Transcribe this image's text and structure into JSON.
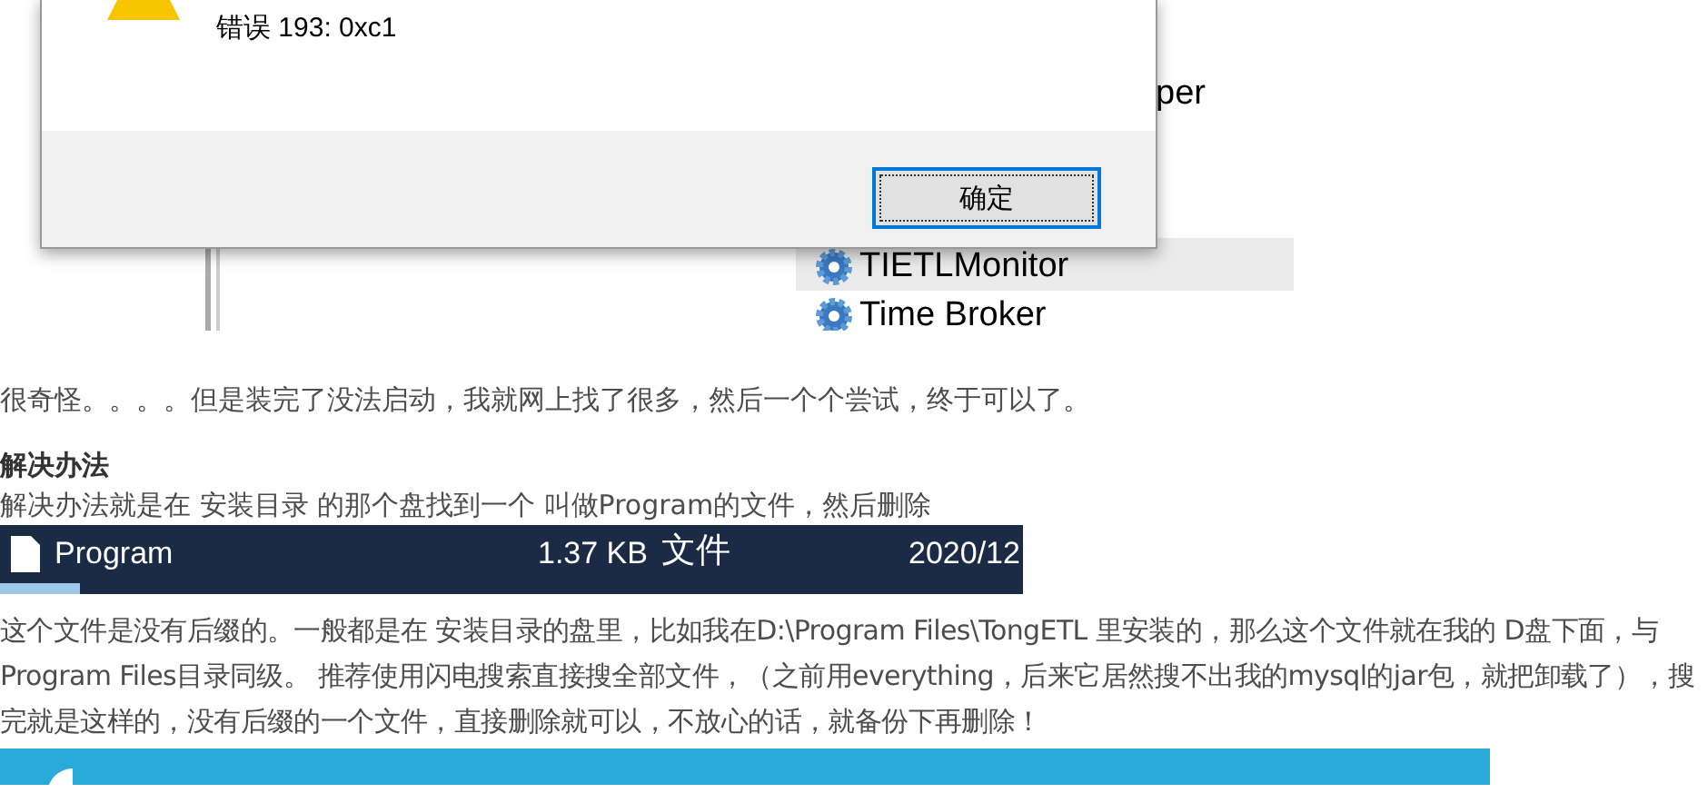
{
  "error_screenshot": {
    "message": "错误 193: 0xc1",
    "ok_button": "确定",
    "services": [
      {
        "name": "per"
      },
      {
        "name": "TIETLMonitor"
      },
      {
        "name": "Time Broker"
      }
    ]
  },
  "intro": "很奇怪。。。。但是装完了没法启动，我就网上找了很多，然后一个个尝试，终于可以了。",
  "heading": "解决办法",
  "solution": "解决办法就是在 安装目录 的那个盘找到一个 叫做Program的文件，然后删除",
  "file_row": {
    "name": "Program",
    "size": "1.37 KB",
    "type": "文件",
    "date": "2020/12"
  },
  "explanation": "这个文件是没有后缀的。一般都是在 安装目录的盘里，比如我在D:\\Program Files\\TongETL 里安装的，那么这个文件就在我的 D盘下面，与Program Files目录同级。 推荐使用闪电搜索直接搜全部文件，（之前用everything，后来它居然搜不出我的mysql的jar包，就把卸载了），搜完就是这样的，没有后缀的一个文件，直接删除就可以，不放心的话，就备份下再删除！"
}
